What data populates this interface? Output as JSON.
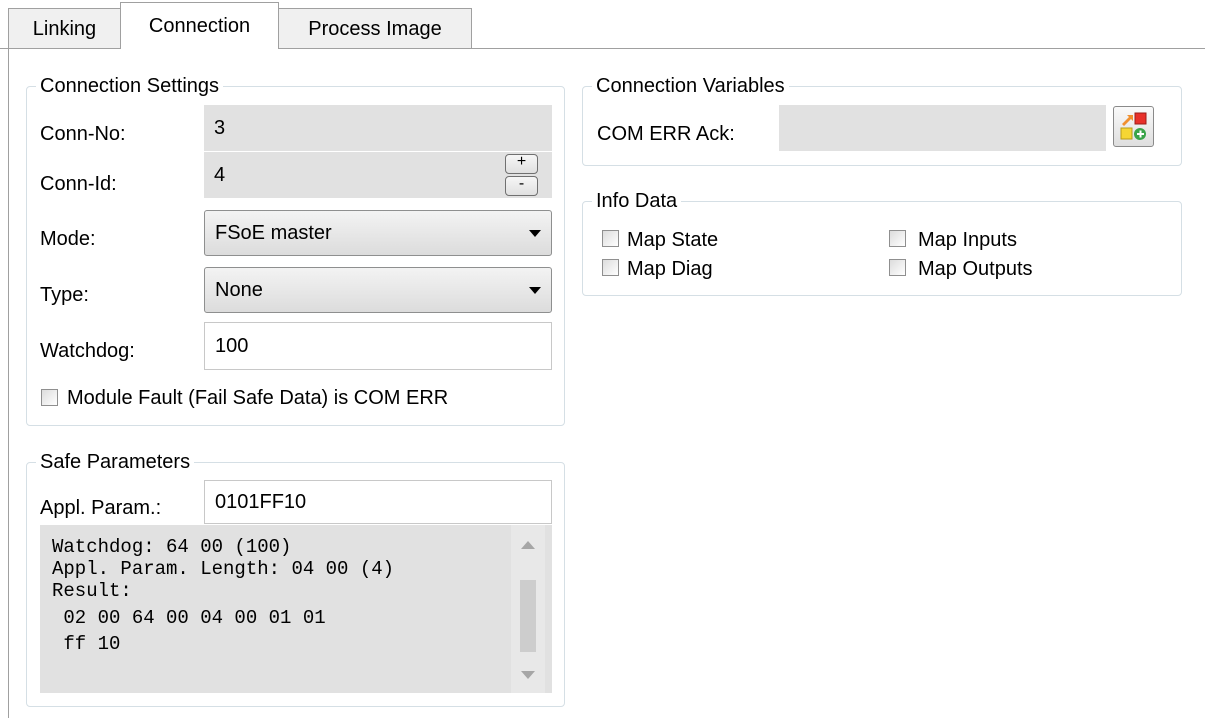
{
  "tabs": [
    {
      "label": "Linking",
      "active": false
    },
    {
      "label": "Connection",
      "active": true
    },
    {
      "label": "Process Image",
      "active": false
    }
  ],
  "connection_settings": {
    "title": "Connection Settings",
    "conn_no_label": "Conn-No:",
    "conn_no_value": "3",
    "conn_id_label": "Conn-Id:",
    "conn_id_value": "4",
    "spin_plus": "+",
    "spin_minus": "-",
    "mode_label": "Mode:",
    "mode_value": "FSoE master",
    "type_label": "Type:",
    "type_value": "None",
    "watchdog_label": "Watchdog:",
    "watchdog_value": "100",
    "module_fault_label": "Module Fault (Fail Safe Data) is COM ERR",
    "module_fault_checked": false
  },
  "safe_parameters": {
    "title": "Safe Parameters",
    "appl_param_label": "Appl. Param.:",
    "appl_param_value": "0101FF10",
    "output_lines": [
      "Watchdog: 64 00 (100)",
      "Appl. Param. Length: 04 00 (4)",
      "Result:",
      " 02 00 64 00 04 00 01 01",
      " ff 10"
    ]
  },
  "connection_variables": {
    "title": "Connection Variables",
    "com_err_ack_label": "COM ERR Ack:",
    "com_err_ack_value": "",
    "link_button_icon": "link-variable-icon"
  },
  "info_data": {
    "title": "Info Data",
    "map_state": "Map State",
    "map_diag": "Map Diag",
    "map_inputs": "Map Inputs",
    "map_outputs": "Map Outputs"
  },
  "colors": {
    "readonly_bg": "#e1e1e1",
    "group_border": "#d5dfe5",
    "tab_border": "#a0a0a0"
  }
}
